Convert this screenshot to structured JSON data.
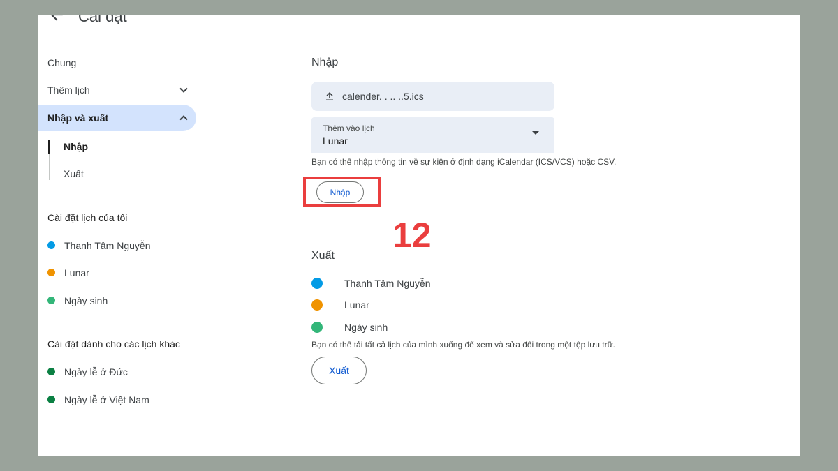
{
  "header": {
    "title": "Cài đặt"
  },
  "sidebar": {
    "items": [
      {
        "label": "Chung"
      },
      {
        "label": "Thêm lịch"
      },
      {
        "label": "Nhập và xuất"
      }
    ],
    "subitems": [
      {
        "label": "Nhập"
      },
      {
        "label": "Xuất"
      }
    ],
    "my_calendars": {
      "heading": "Cài đặt lịch của tôi",
      "items": [
        {
          "label": "Thanh Tâm Nguyễn",
          "color": "#039be5"
        },
        {
          "label": "Lunar",
          "color": "#f09300"
        },
        {
          "label": "Ngày sinh",
          "color": "#33b679"
        }
      ]
    },
    "other_calendars": {
      "heading": "Cài đặt dành cho các lịch khác",
      "items": [
        {
          "label": "Ngày lễ ở Đức",
          "color": "#0b8043"
        },
        {
          "label": "Ngày lễ ở Việt Nam",
          "color": "#0b8043"
        }
      ]
    }
  },
  "import": {
    "title": "Nhập",
    "file_name": "calender. . .. ..5.ics",
    "select_label": "Thêm vào lịch",
    "select_value": "Lunar",
    "hint": "Bạn có thể nhập thông tin về sự kiện ở định dạng iCalendar (ICS/VCS) hoặc CSV.",
    "button_label": "Nhập",
    "highlight_color": "#ea3e3e"
  },
  "annotation": {
    "step": "12"
  },
  "export": {
    "title": "Xuất",
    "items": [
      {
        "label": "Thanh Tâm Nguyễn",
        "color": "#039be5"
      },
      {
        "label": "Lunar",
        "color": "#f09300"
      },
      {
        "label": "Ngày sinh",
        "color": "#33b679"
      }
    ],
    "hint": "Bạn có thể tải tất cả lịch của mình xuống để xem và sửa đổi trong một tệp lưu trữ.",
    "button_label": "Xuất"
  }
}
